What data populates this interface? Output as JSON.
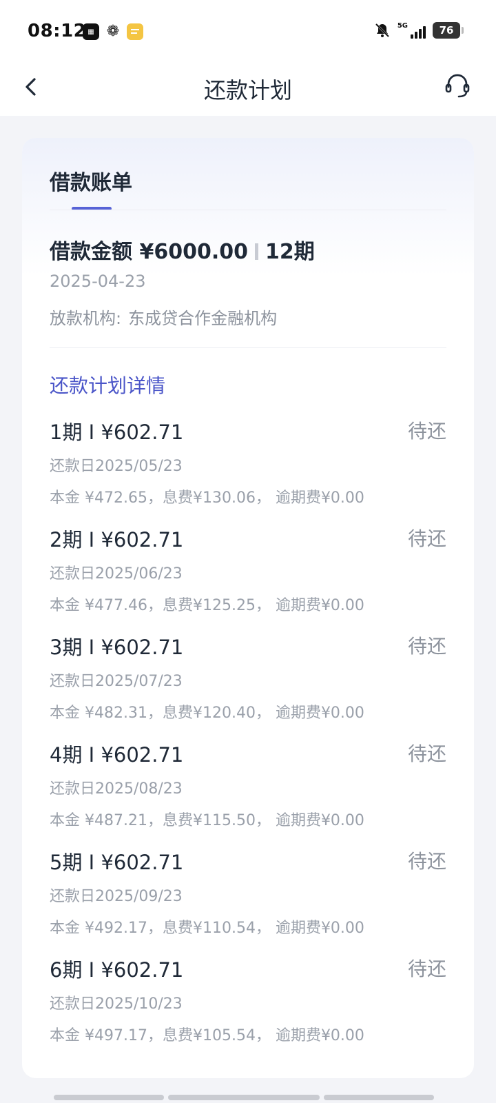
{
  "status_bar": {
    "time": "08:12",
    "network": "5G",
    "battery": "76"
  },
  "nav": {
    "title": "还款计划"
  },
  "bill": {
    "section_title": "借款账单",
    "amount_label": "借款金额 ¥6000.00",
    "periods_label": "12期",
    "date": "2025-04-23",
    "lender_label": "放款机构:",
    "lender_value": "东成贷合作金融机构"
  },
  "plan": {
    "title": "还款计划详情",
    "items": [
      {
        "head": "1期 I ¥602.71",
        "status": "待还",
        "date": "还款日2025/05/23",
        "detail": "本金 ¥472.65，息费¥130.06， 逾期费¥0.00"
      },
      {
        "head": "2期 I ¥602.71",
        "status": "待还",
        "date": "还款日2025/06/23",
        "detail": "本金 ¥477.46，息费¥125.25， 逾期费¥0.00"
      },
      {
        "head": "3期 I ¥602.71",
        "status": "待还",
        "date": "还款日2025/07/23",
        "detail": "本金 ¥482.31，息费¥120.40， 逾期费¥0.00"
      },
      {
        "head": "4期 I ¥602.71",
        "status": "待还",
        "date": "还款日2025/08/23",
        "detail": "本金 ¥487.21，息费¥115.50， 逾期费¥0.00"
      },
      {
        "head": "5期 I ¥602.71",
        "status": "待还",
        "date": "还款日2025/09/23",
        "detail": "本金 ¥492.17，息费¥110.54， 逾期费¥0.00"
      },
      {
        "head": "6期 I ¥602.71",
        "status": "待还",
        "date": "还款日2025/10/23",
        "detail": "本金 ¥497.17，息费¥105.54， 逾期费¥0.00"
      }
    ]
  },
  "colors": {
    "accent": "#5763d6",
    "link": "#4a55c8",
    "background": "#f3f4f8"
  }
}
